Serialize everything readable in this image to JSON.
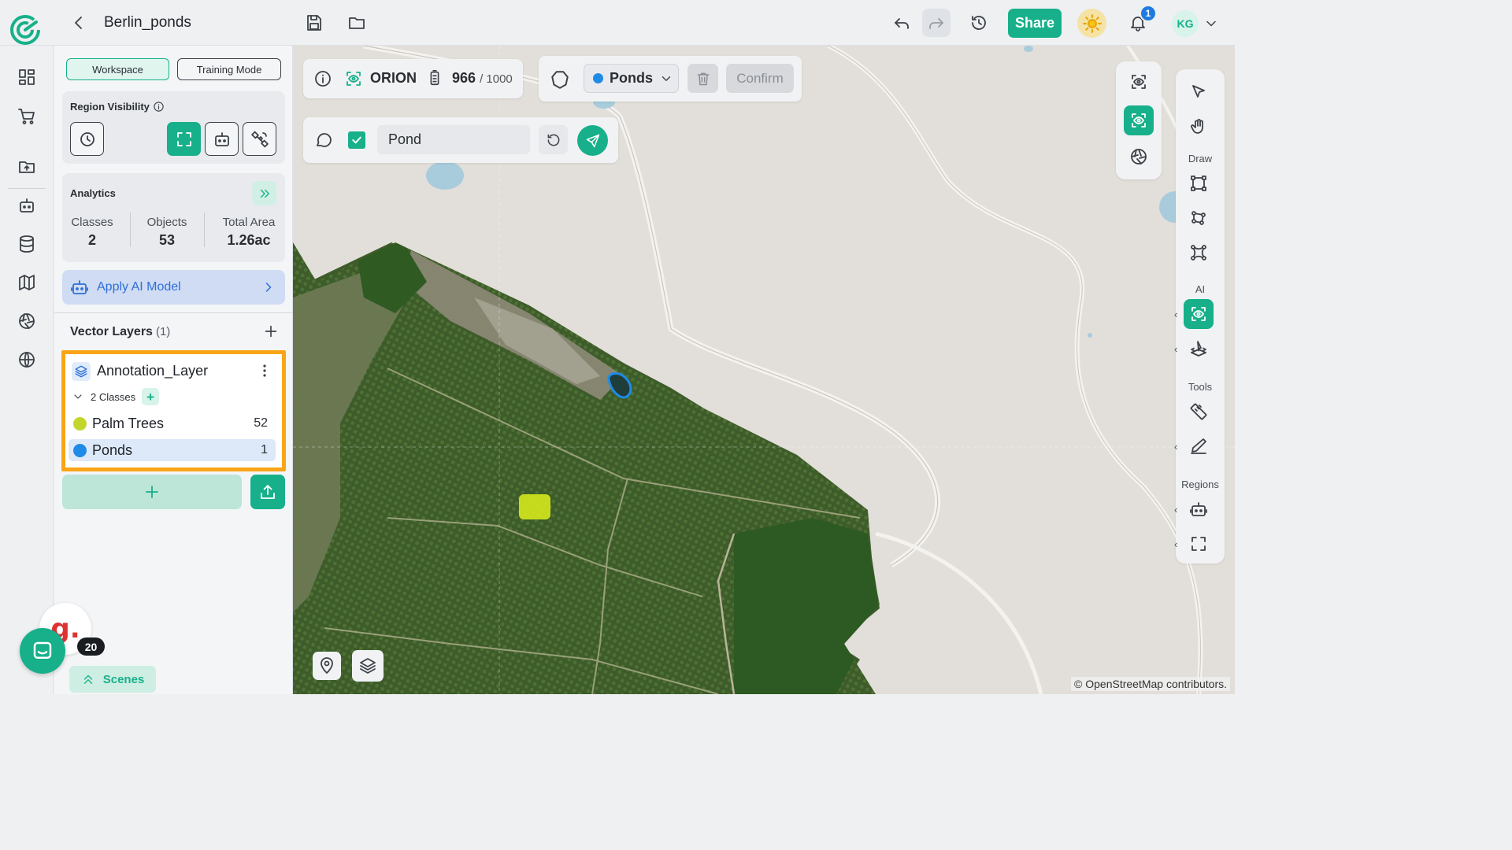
{
  "header": {
    "title": "Berlin_ponds",
    "share_label": "Share",
    "notification_count": "1",
    "user_initials": "KG"
  },
  "panel": {
    "workspace_label": "Workspace",
    "training_label": "Training Mode",
    "region_visibility_title": "Region Visibility",
    "analytics_title": "Analytics",
    "stats": [
      {
        "label": "Classes",
        "value": "2"
      },
      {
        "label": "Objects",
        "value": "53"
      },
      {
        "label": "Total Area",
        "value": "1.26ac"
      }
    ],
    "apply_ai_label": "Apply AI Model",
    "vector_layers_title": "Vector Layers",
    "vector_layers_count": "(1)",
    "layer": {
      "name": "Annotation_Layer",
      "classes_label": "2 Classes",
      "classes": [
        {
          "name": "Palm Trees",
          "count": "52",
          "color": "#c3d62c"
        },
        {
          "name": "Ponds",
          "count": "1",
          "color": "#1f8be6"
        }
      ]
    },
    "scenes_label": "Scenes"
  },
  "chat": {
    "badge_count": "20",
    "brand_letter": "g."
  },
  "map": {
    "model_name": "ORION",
    "credits_used": "966",
    "credits_max": "/ 1000",
    "selected_class": "Ponds",
    "confirm_label": "Confirm",
    "prompt_value": "Pond",
    "right_labels": {
      "draw": "Draw",
      "ai": "AI",
      "tools": "Tools",
      "regions": "Regions"
    },
    "attribution": "© OpenStreetMap contributors."
  },
  "colors": {
    "accent": "#17b08a",
    "highlight": "#f9a517",
    "ai_blue": "#2f6fd8"
  }
}
